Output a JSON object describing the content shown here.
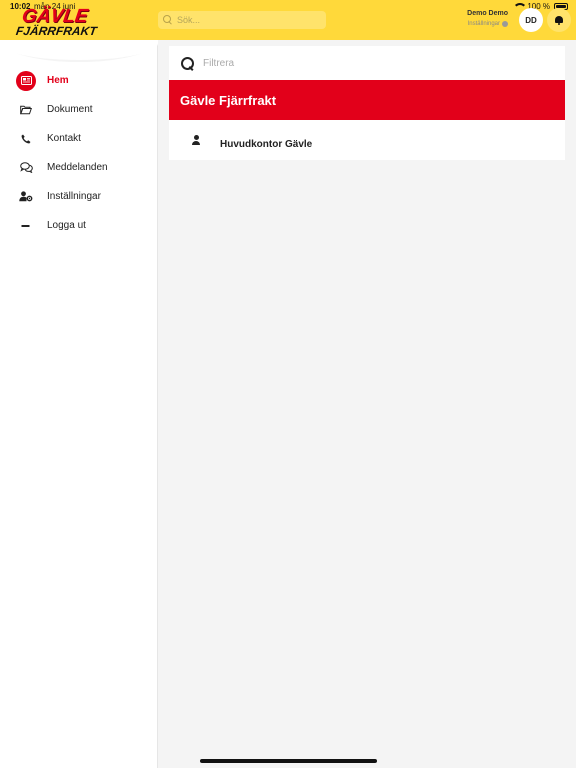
{
  "status_bar": {
    "time": "10:02",
    "date": "mån 24 juni",
    "battery": "100 %",
    "battery_level_percent": 100
  },
  "header": {
    "logo_text_top": "GÄVLE",
    "logo_text_bottom": "FJÄRRFRAKT",
    "search_placeholder": "Sök...",
    "user_name": "Demo Demo",
    "user_settings_label": "Inställningar",
    "avatar_initials": "DD",
    "brand_color": "#ffd93a",
    "accent_color": "#e2001a"
  },
  "sidebar": {
    "items": [
      {
        "label": "Hem",
        "icon": "newspaper-icon",
        "active": true
      },
      {
        "label": "Dokument",
        "icon": "folder-open-icon",
        "active": false
      },
      {
        "label": "Kontakt",
        "icon": "phone-icon",
        "active": false
      },
      {
        "label": "Meddelanden",
        "icon": "chat-bubbles-icon",
        "active": false
      },
      {
        "label": "Inställningar",
        "icon": "user-gear-icon",
        "active": false
      },
      {
        "label": "Logga ut",
        "icon": "minus-icon",
        "active": false
      }
    ]
  },
  "main": {
    "filter_placeholder": "Filtrera",
    "group_title": "Gävle Fjärrfrakt",
    "contacts": [
      {
        "name": "Huvudkontor Gävle",
        "icon": "person-icon"
      }
    ]
  }
}
